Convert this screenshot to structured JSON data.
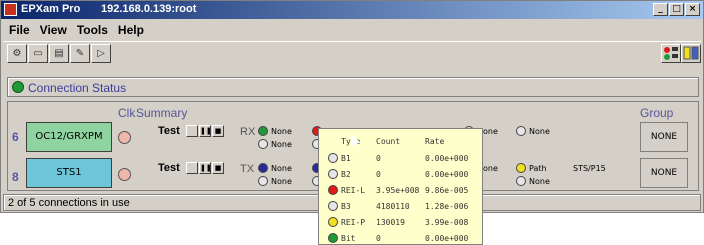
{
  "window": {
    "app_name": "EPXam Pro",
    "host": "192.168.0.139:root",
    "controls": [
      "_",
      "□",
      "×"
    ]
  },
  "menu": [
    "File",
    "View",
    "Tools",
    "Help"
  ],
  "toolbar_icons": [
    "connect-icon",
    "card-icon",
    "database-icon",
    "edit-icon",
    "play-icon"
  ],
  "connection_status": {
    "label": "Connection Status"
  },
  "columns": {
    "clk": "Clk",
    "summary": "Summary",
    "group": "Group"
  },
  "rows": [
    {
      "num": "6",
      "port": "OC12/GRXPM",
      "port_color": "#8fd4a0",
      "test_label": "Test",
      "direction": "RX",
      "group": "NONE",
      "leds_top": [
        {
          "color": "#1e9a3a",
          "label": "None"
        },
        {
          "color": "#e01818",
          "label": ""
        },
        {
          "color": "#e6e6e6",
          "label": "None"
        },
        {
          "color": "#e6e6e6",
          "label": "None"
        }
      ],
      "leds_bottom": [
        {
          "color": "#e6e6e6",
          "label": "None"
        },
        {
          "color": "#e6e6e6",
          "label": ""
        }
      ],
      "extra": ""
    },
    {
      "num": "8",
      "port": "STS1",
      "port_color": "#6cc6d8",
      "test_label": "Test",
      "direction": "TX",
      "group": "NONE",
      "leds_top": [
        {
          "color": "#2a2a9a",
          "label": "None"
        },
        {
          "color": "#2a2a9a",
          "label": ""
        },
        {
          "color": "#e6e6e6",
          "label": "None"
        },
        {
          "color": "#f0e020",
          "label": "Path"
        }
      ],
      "leds_bottom": [
        {
          "color": "#e6e6e6",
          "label": "None"
        },
        {
          "color": "#e6e6e6",
          "label": ""
        },
        {
          "color": "#e6e6e6",
          "label": "None"
        }
      ],
      "extra": "STS/P15"
    }
  ],
  "status_bar": "2 of 5 connections in use",
  "tooltip": {
    "headers": [
      "Type",
      "Count",
      "Rate"
    ],
    "rows": [
      {
        "color": "#e6e6e6",
        "type": "B1",
        "count": "0",
        "rate": "0.00e+000"
      },
      {
        "color": "#e6e6e6",
        "type": "B2",
        "count": "0",
        "rate": "0.00e+000"
      },
      {
        "color": "#e01818",
        "type": "REI-L",
        "count": "3.95e+008",
        "rate": "9.86e-005"
      },
      {
        "color": "#e6e6e6",
        "type": "B3",
        "count": "4180110",
        "rate": "1.28e-006"
      },
      {
        "color": "#f0e020",
        "type": "REI-P",
        "count": "130019",
        "rate": "3.99e-008"
      },
      {
        "color": "#1e9a3a",
        "type": "Bit",
        "count": "0",
        "rate": "0.00e+000"
      }
    ]
  }
}
